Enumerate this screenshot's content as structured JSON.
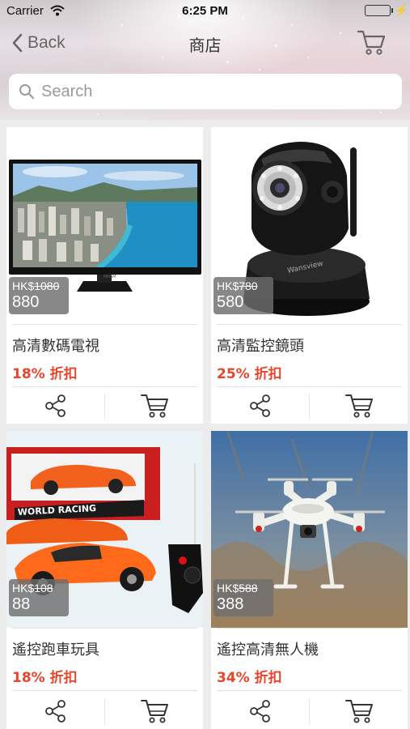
{
  "status_bar": {
    "carrier": "Carrier",
    "time": "6:25 PM"
  },
  "nav": {
    "back_label": "Back",
    "title": "商店"
  },
  "search": {
    "placeholder": "Search"
  },
  "products": [
    {
      "name": "高清數碼電視",
      "currency": "HK$",
      "old_price": "1080",
      "price": "880",
      "discount": "18% 折扣"
    },
    {
      "name": "高清監控鏡頭",
      "currency": "HK$",
      "old_price": "780",
      "price": "580",
      "discount": "25% 折扣"
    },
    {
      "name": "遙控跑車玩具",
      "currency": "HK$",
      "old_price": "108",
      "price": "88",
      "discount": "18% 折扣"
    },
    {
      "name": "遙控高清無人機",
      "currency": "HK$",
      "old_price": "588",
      "price": "388",
      "discount": "34% 折扣"
    }
  ],
  "colors": {
    "discount": "#e8452c",
    "battery": "#3ec244",
    "price_tag_bg": "#6e6e6e"
  },
  "icons": [
    "chevron-left-icon",
    "cart-icon",
    "search-icon",
    "share-icon",
    "wifi-icon",
    "battery-icon"
  ]
}
